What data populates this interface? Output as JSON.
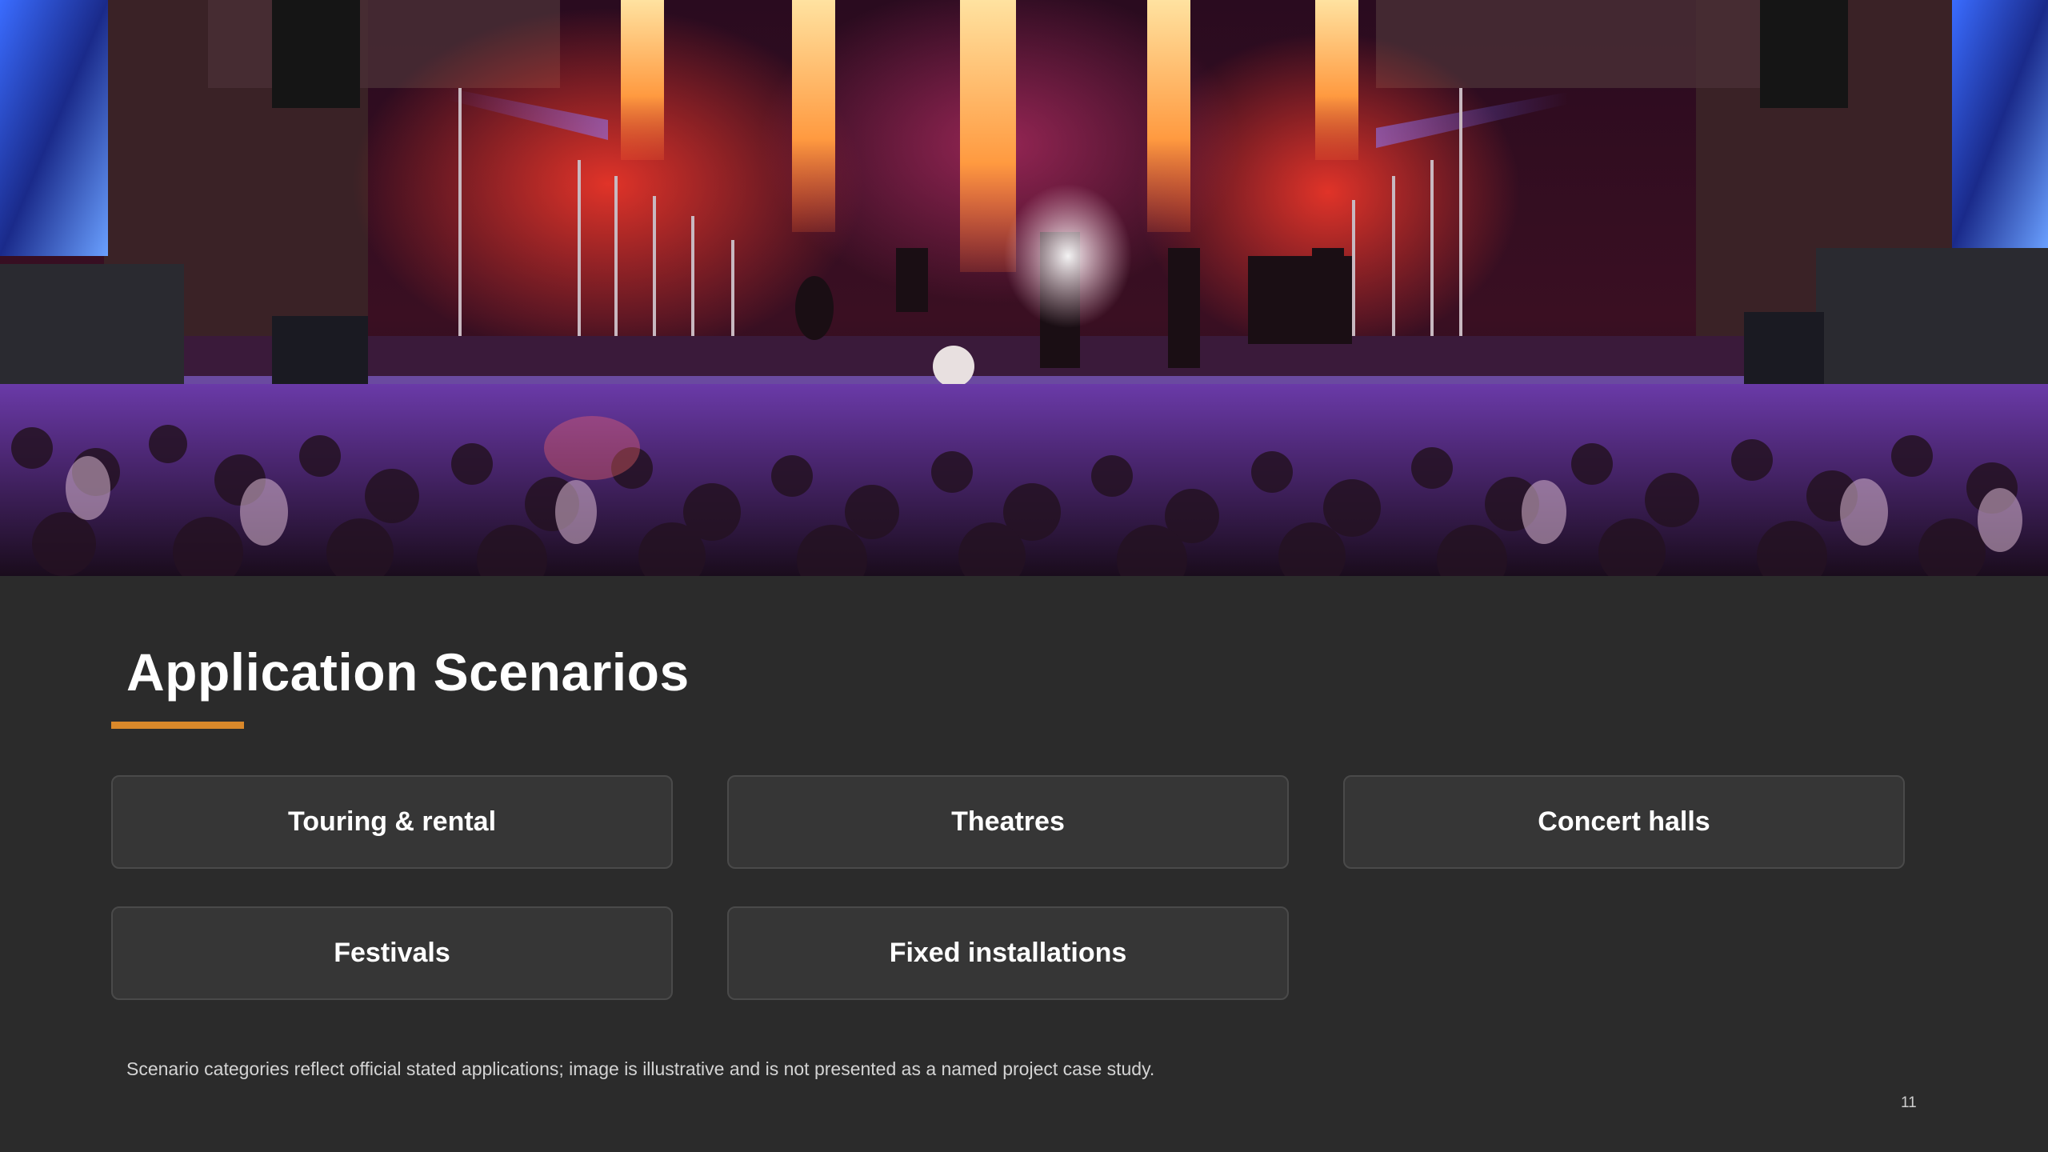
{
  "hero": {
    "image": "concert-stage-photo"
  },
  "slide": {
    "title": "Application Scenarios",
    "accent_color": "#d9882a",
    "background_color": "#2b2b2b",
    "cards": [
      {
        "label": "Touring & rental"
      },
      {
        "label": "Theatres"
      },
      {
        "label": "Concert halls"
      },
      {
        "label": "Festivals"
      },
      {
        "label": "Fixed installations"
      }
    ],
    "footnote": "Scenario categories reflect official stated applications; image is illustrative and is not presented as a named project case study.",
    "page_number": "11"
  }
}
